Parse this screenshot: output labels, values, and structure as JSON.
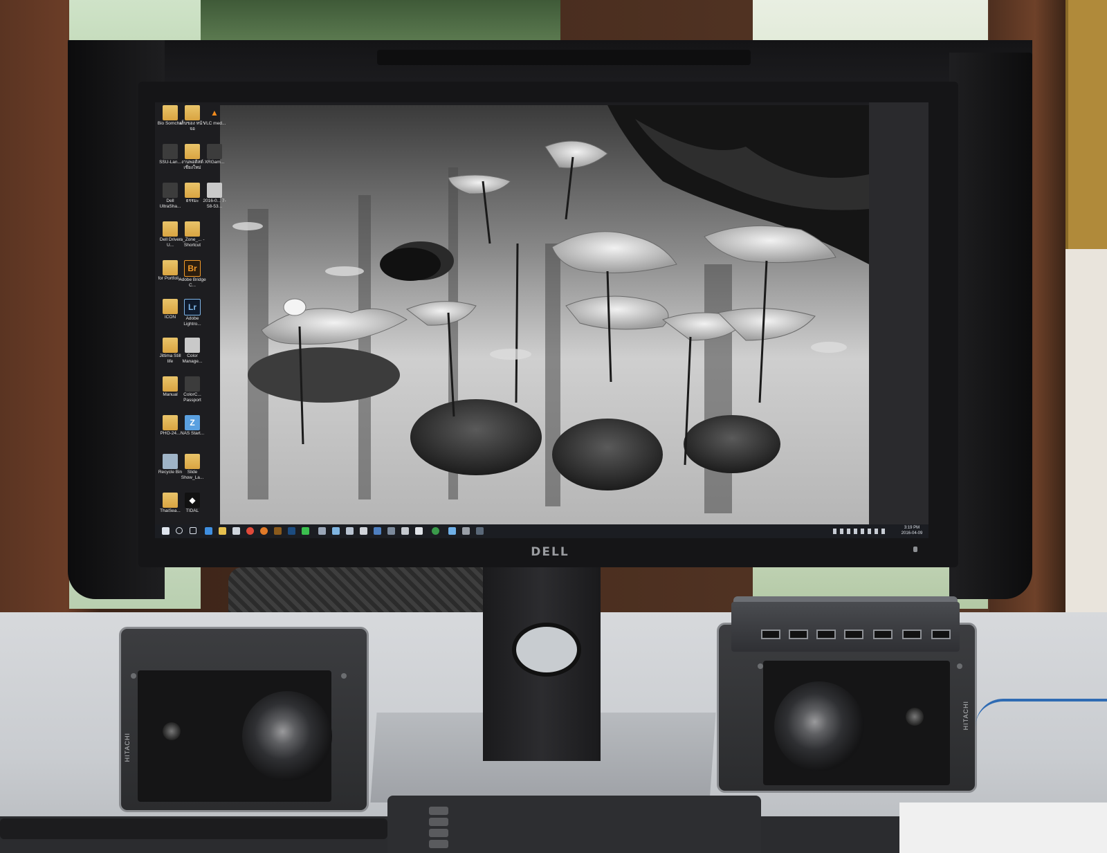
{
  "scene": {
    "description_visible": false
  },
  "monitor": {
    "brand_logo": "DELL"
  },
  "desktop": {
    "icons": [
      {
        "label": "Bio Somchai",
        "glyph": "",
        "style": "folder"
      },
      {
        "label": "เก็บของ หน้าจอ",
        "glyph": "",
        "style": "folder"
      },
      {
        "label": "VLC med...",
        "glyph": "▲",
        "style": "vlc"
      },
      {
        "label": "SSU-Lan...",
        "glyph": "",
        "style": "dark"
      },
      {
        "label": "งานพอติสต์ เชียงใหม่",
        "glyph": "",
        "style": "folder"
      },
      {
        "label": "XRGam...",
        "glyph": "",
        "style": "dark"
      },
      {
        "label": "Dell UltraSha...",
        "glyph": "",
        "style": "dark"
      },
      {
        "label": "ธรรมะ",
        "glyph": "",
        "style": "folder"
      },
      {
        "label": "2016-0... 7-58-53...",
        "glyph": "",
        "style": "plain"
      },
      {
        "label": "Dell Driver U...",
        "glyph": "",
        "style": "folder"
      },
      {
        "label": "a_Zone_... - Shortcut",
        "glyph": "",
        "style": "folder"
      },
      {
        "label": "for Portfoli...",
        "glyph": "",
        "style": "folder"
      },
      {
        "label": "Adobe Bridge C...",
        "glyph": "Br",
        "style": "br"
      },
      {
        "label": "ICON",
        "glyph": "",
        "style": "folder"
      },
      {
        "label": "Adobe Lightro...",
        "glyph": "Lr",
        "style": "lr"
      },
      {
        "label": "Jittima Still life",
        "glyph": "",
        "style": "folder"
      },
      {
        "label": "Color Manage...",
        "glyph": "",
        "style": "plain"
      },
      {
        "label": "Manual",
        "glyph": "",
        "style": "folder"
      },
      {
        "label": "ColorC... Passport",
        "glyph": "",
        "style": "dark"
      },
      {
        "label": "PHO-24...",
        "glyph": "",
        "style": "folder"
      },
      {
        "label": "NAS Start...",
        "glyph": "Z",
        "style": "nas"
      },
      {
        "label": "Recycle Bin",
        "glyph": "",
        "style": "recycle"
      },
      {
        "label": "Slide Show_La...",
        "glyph": "",
        "style": "folder"
      },
      {
        "label": "ThaiSea...",
        "glyph": "",
        "style": "folder"
      },
      {
        "label": "TIDAL",
        "glyph": "◆",
        "style": "tidal"
      }
    ],
    "taskbar": {
      "clock_time": "3:19 PM",
      "clock_date": "2016-04-09"
    }
  },
  "speakers": {
    "brand": "HITACHI"
  },
  "hub": {
    "port_label": "USB"
  },
  "colors": {
    "desk": "#c9ccd0",
    "monitor": "#151517",
    "speaker_trim": "#8a8c90",
    "cable": "#2f6bb3"
  }
}
